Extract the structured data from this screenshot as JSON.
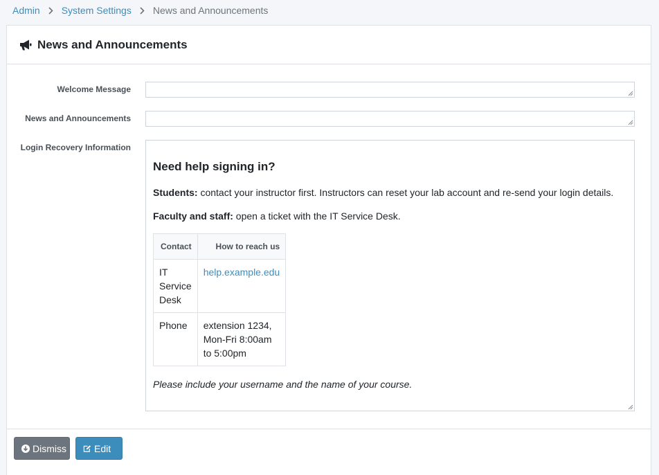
{
  "breadcrumb": {
    "items": [
      "Admin",
      "System Settings"
    ],
    "current": "News and Announcements"
  },
  "card": {
    "title": "News and Announcements",
    "icon": "bullhorn-icon"
  },
  "form": {
    "welcome_label": "Welcome Message",
    "welcome_value": "",
    "news_label": "News and Announcements",
    "news_value": "",
    "recovery_label": "Login Recovery Information",
    "recovery": {
      "heading": "Need help signing in?",
      "students_strong": "Students:",
      "students_text": " contact your instructor first. Instructors can reset your lab account and re-send your login details.",
      "faculty_strong": "Faculty and staff:",
      "faculty_text": " open a ticket with the IT Service Desk.",
      "table": {
        "headers": [
          "Contact",
          "How to reach us"
        ],
        "rows": [
          {
            "contact": "IT Service Desk",
            "reach": "help.example.edu",
            "link": true
          },
          {
            "contact": "Phone",
            "reach": "extension 1234, Mon-Fri 8:00am to 5:00pm",
            "link": false
          }
        ]
      },
      "note": "Please include your username and the name of your course."
    }
  },
  "buttons": {
    "dismiss": "Dismiss",
    "edit": "Edit"
  },
  "colors": {
    "link": "#3c8dbc",
    "dismiss_bg": "#6c757d",
    "edit_bg": "#3c8dbc"
  }
}
